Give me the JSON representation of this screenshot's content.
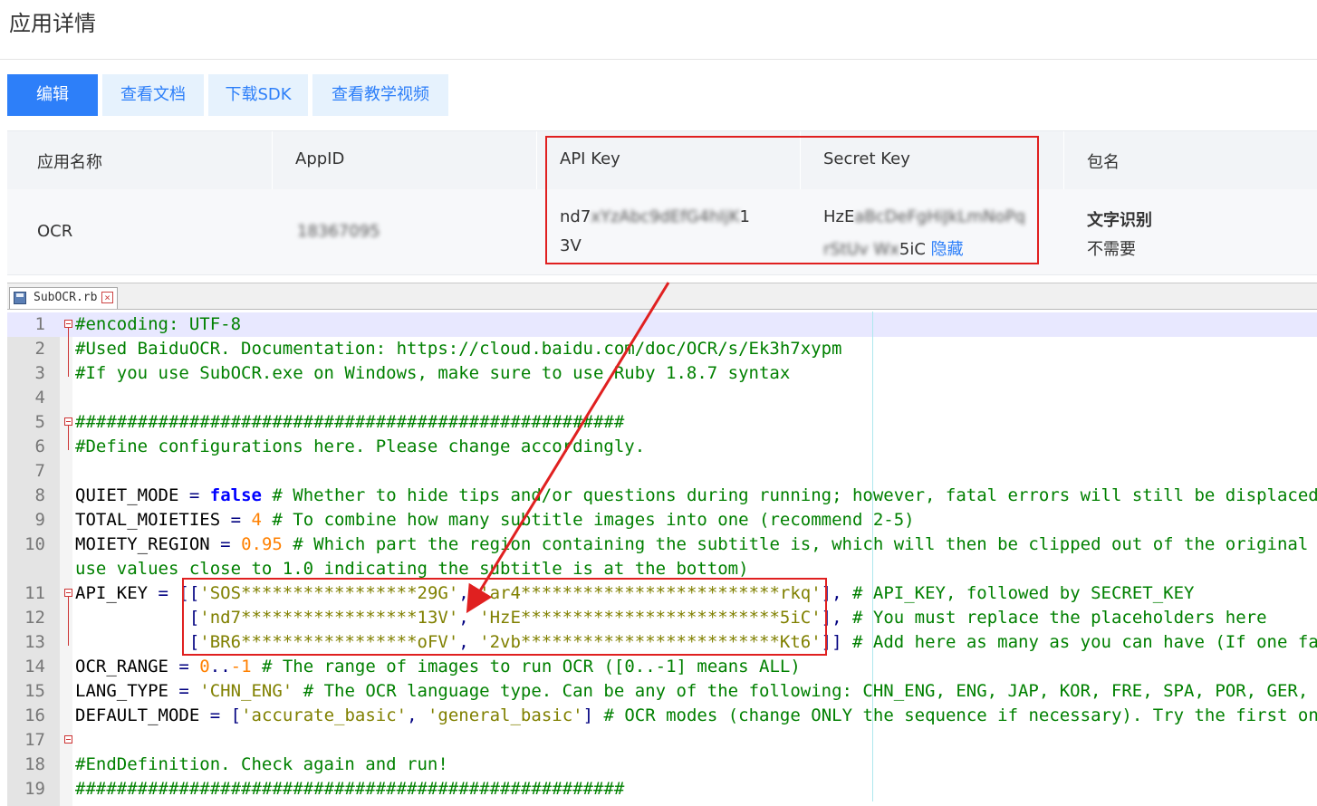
{
  "page": {
    "title": "应用详情"
  },
  "toolbar": {
    "buttons": [
      {
        "label": "编辑"
      },
      {
        "label": "查看文档"
      },
      {
        "label": "下载SDK"
      },
      {
        "label": "查看教学视频"
      }
    ]
  },
  "app_table": {
    "headers": [
      "应用名称",
      "AppID",
      "API Key",
      "Secret Key",
      "包名"
    ],
    "row": {
      "name": "OCR",
      "appid_masked": "18367095",
      "api_key_line1_prefix": "nd7",
      "api_key_line1_masked": "xYzAbc9dEfG4hIjK",
      "api_key_line1_suffix": "1",
      "api_key_line2": "3V",
      "secret_key_line1_prefix": "HzE",
      "secret_key_line1_masked": "aBcDeFgHiJkLmNoPq",
      "secret_key_line2_masked": "rStUv Wx",
      "secret_key_line2_suffix": "5iC",
      "hide_link": "隐藏",
      "package_title": "文字识别",
      "package_value": "不需要"
    }
  },
  "editor": {
    "tab_name": "SubOCR.rb",
    "lines": [
      {
        "n": "1",
        "tokens": [
          {
            "t": "#encoding: UTF-8",
            "c": "com"
          }
        ]
      },
      {
        "n": "2",
        "tokens": [
          {
            "t": "#Used BaiduOCR. Documentation: https://cloud.baidu.com/doc/OCR/s/Ek3h7xypm",
            "c": "com"
          }
        ]
      },
      {
        "n": "3",
        "tokens": [
          {
            "t": "#If you use SubOCR.exe on Windows, make sure to use Ruby 1.8.7 syntax",
            "c": "com"
          }
        ]
      },
      {
        "n": "4",
        "tokens": []
      },
      {
        "n": "5",
        "tokens": [
          {
            "t": "#####################################################",
            "c": "com"
          }
        ]
      },
      {
        "n": "6",
        "tokens": [
          {
            "t": "#Define configurations here. Please change accordingly.",
            "c": "com"
          }
        ]
      },
      {
        "n": "7",
        "tokens": []
      },
      {
        "n": "8",
        "tokens": [
          {
            "t": "QUIET_MODE ",
            "c": "id"
          },
          {
            "t": "=",
            "c": "op"
          },
          {
            "t": " ",
            "c": "id"
          },
          {
            "t": "false",
            "c": "kw"
          },
          {
            "t": " # Whether to hide tips and/or questions during running; however, fatal errors will still be displaced anyway",
            "c": "com"
          }
        ]
      },
      {
        "n": "9",
        "tokens": [
          {
            "t": "TOTAL_MOIETIES ",
            "c": "id"
          },
          {
            "t": "=",
            "c": "op"
          },
          {
            "t": " ",
            "c": "id"
          },
          {
            "t": "4",
            "c": "num"
          },
          {
            "t": " # To combine how many subtitle images into one (recommend 2-5)",
            "c": "com"
          }
        ]
      },
      {
        "n": "10",
        "tokens": [
          {
            "t": "MOIETY_REGION ",
            "c": "id"
          },
          {
            "t": "=",
            "c": "op"
          },
          {
            "t": " ",
            "c": "id"
          },
          {
            "t": "0.95",
            "c": "num"
          },
          {
            "t": " # Which part the region containing the subtitle is, which will then be clipped out of the original image",
            "c": "com"
          }
        ]
      },
      {
        "n": "",
        "tokens": [
          {
            "t": "use values close to 1.0 indicating the subtitle is at the bottom)",
            "c": "com"
          }
        ]
      },
      {
        "n": "11",
        "tokens": [
          {
            "t": "API_KEY ",
            "c": "id"
          },
          {
            "t": "=",
            "c": "op"
          },
          {
            "t": " [[",
            "c": "op"
          },
          {
            "t": "'SOS*****************29G'",
            "c": "str"
          },
          {
            "t": ", ",
            "c": "op"
          },
          {
            "t": "'ar4*************************rkq'",
            "c": "str"
          },
          {
            "t": "],",
            "c": "op"
          },
          {
            "t": " # API_KEY, followed by SECRET_KEY",
            "c": "com"
          }
        ]
      },
      {
        "n": "12",
        "tokens": [
          {
            "t": "           ",
            "c": "id"
          },
          {
            "t": "[",
            "c": "op"
          },
          {
            "t": "'nd7*****************13V'",
            "c": "str"
          },
          {
            "t": ", ",
            "c": "op"
          },
          {
            "t": "'HzE*************************5iC'",
            "c": "str"
          },
          {
            "t": "],",
            "c": "op"
          },
          {
            "t": " # You must replace the placeholders here",
            "c": "com"
          }
        ]
      },
      {
        "n": "13",
        "tokens": [
          {
            "t": "           ",
            "c": "id"
          },
          {
            "t": "[",
            "c": "op"
          },
          {
            "t": "'BR6*****************oFV'",
            "c": "str"
          },
          {
            "t": ", ",
            "c": "op"
          },
          {
            "t": "'2vb*************************Kt6'",
            "c": "str"
          },
          {
            "t": "]]",
            "c": "op"
          },
          {
            "t": " # Add here as many as you can have (If one fails, the next will be used)",
            "c": "com"
          }
        ]
      },
      {
        "n": "14",
        "tokens": [
          {
            "t": "OCR_RANGE ",
            "c": "id"
          },
          {
            "t": "=",
            "c": "op"
          },
          {
            "t": " ",
            "c": "id"
          },
          {
            "t": "0",
            "c": "num"
          },
          {
            "t": "..",
            "c": "op"
          },
          {
            "t": "-1",
            "c": "num"
          },
          {
            "t": " # The range of images to run OCR ([0..-1] means ALL)",
            "c": "com"
          }
        ]
      },
      {
        "n": "15",
        "tokens": [
          {
            "t": "LANG_TYPE ",
            "c": "id"
          },
          {
            "t": "=",
            "c": "op"
          },
          {
            "t": " ",
            "c": "id"
          },
          {
            "t": "'CHN_ENG'",
            "c": "str"
          },
          {
            "t": " # The OCR language type. Can be any of the following: CHN_ENG, ENG, JAP, KOR, FRE, SPA, POR, GER, ITA, RUS",
            "c": "com"
          }
        ]
      },
      {
        "n": "16",
        "tokens": [
          {
            "t": "DEFAULT_MODE ",
            "c": "id"
          },
          {
            "t": "=",
            "c": "op"
          },
          {
            "t": " [",
            "c": "op"
          },
          {
            "t": "'accurate_basic'",
            "c": "str"
          },
          {
            "t": ", ",
            "c": "op"
          },
          {
            "t": "'general_basic'",
            "c": "str"
          },
          {
            "t": "]",
            "c": "op"
          },
          {
            "t": " # OCR modes (change ONLY the sequence if necessary). Try the first one; if it fails, try the next",
            "c": "com"
          }
        ]
      },
      {
        "n": "17",
        "tokens": []
      },
      {
        "n": "18",
        "tokens": [
          {
            "t": "#EndDefinition. Check again and run!",
            "c": "com"
          }
        ]
      },
      {
        "n": "19",
        "tokens": [
          {
            "t": "#####################################################",
            "c": "com"
          }
        ]
      }
    ]
  },
  "colors": {
    "primary": "#2d7ff9",
    "annotation_red": "#e02020",
    "comment": "#008000",
    "keyword": "#0000ff",
    "number": "#ff8000",
    "string": "#808000"
  }
}
